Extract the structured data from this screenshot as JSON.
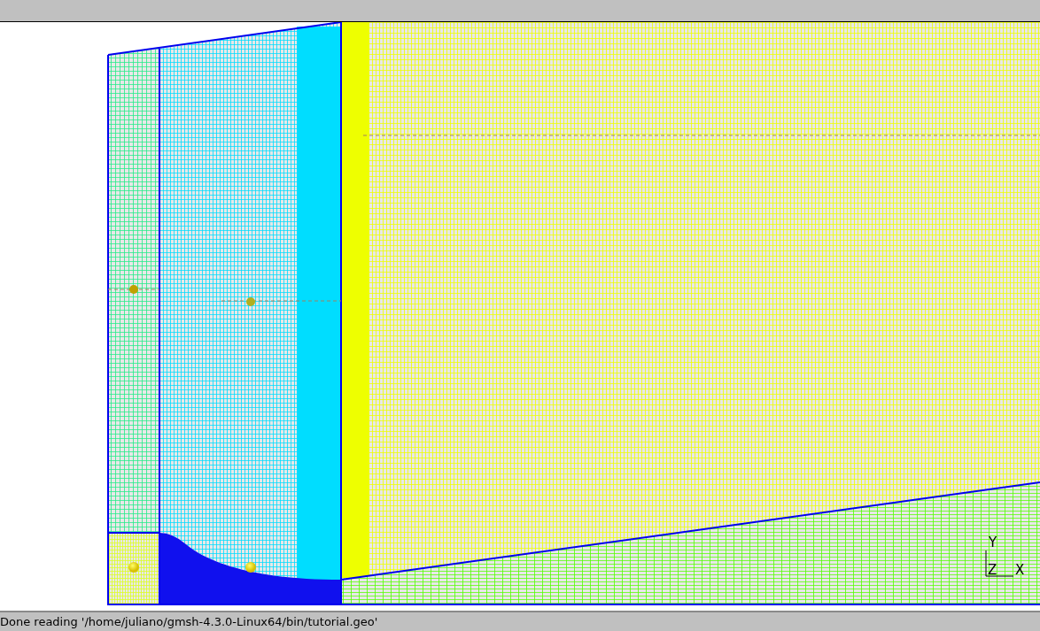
{
  "viewport": {
    "axis_labels": [
      "Y",
      "Z",
      "X"
    ]
  },
  "status_bar": {
    "message": "Done reading '/home/juliano/gmsh-4.3.0-Linux64/bin/tutorial.geo'"
  }
}
